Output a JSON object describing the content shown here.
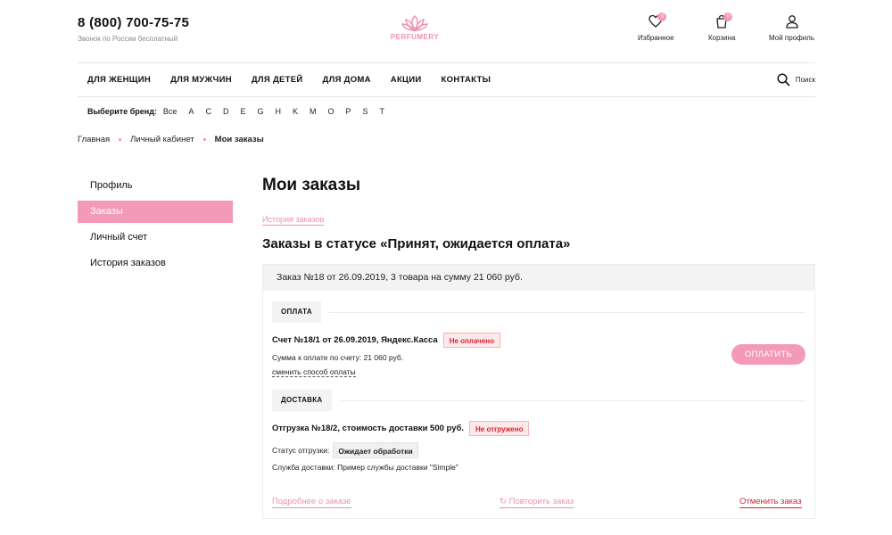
{
  "header": {
    "phone": "8 (800) 700-75-75",
    "phone_note": "Звонок по России бесплатный",
    "logo_text": "PERFUMERY",
    "favorites": {
      "label": "Избранное",
      "count": "0"
    },
    "cart": {
      "label": "Корзина",
      "count": "0"
    },
    "profile": {
      "label": "Мой профиль"
    }
  },
  "nav": {
    "items": [
      "ДЛЯ ЖЕНЩИН",
      "ДЛЯ МУЖЧИН",
      "ДЛЯ ДЕТЕЙ",
      "ДЛЯ ДОМА",
      "АКЦИИ",
      "КОНТАКТЫ"
    ],
    "search_label": "Поиск"
  },
  "brands": {
    "label": "Выберите бренд:",
    "letters": [
      "Все",
      "A",
      "C",
      "D",
      "E",
      "G",
      "H",
      "K",
      "M",
      "O",
      "P",
      "S",
      "T"
    ]
  },
  "breadcrumb": [
    "Главная",
    "Личный кабинет",
    "Мои заказы"
  ],
  "sidebar": {
    "items": [
      "Профиль",
      "Заказы",
      "Личный счет",
      "История заказов"
    ],
    "active_index": 1
  },
  "main": {
    "title": "Мои заказы",
    "history_link": "История заказов",
    "status_title": "Заказы в статусе «Принят, ожидается оплата»"
  },
  "order": {
    "header": "Заказ №18 от 26.09.2019, 3 товара на сумму 21 060 руб.",
    "payment": {
      "section": "ОПЛАТА",
      "invoice": "Счет №18/1 от 26.09.2019, Яндекс.Касса",
      "status": "Не оплачено",
      "amount": "Сумма к оплате по счету: 21 060 руб.",
      "change_link": "сменить способ оплаты",
      "pay_button": "ОПЛАТИТЬ"
    },
    "delivery": {
      "section": "ДОСТАВКА",
      "shipment": "Отгрузка №18/2, стоимость доставки 500 руб.",
      "status": "Не отгружено",
      "ship_status_label": "Статус отгрузки:",
      "ship_status_value": "Ожидает обработки",
      "service": "Служба доставки: Пример службы доставки \"Simple\""
    },
    "footer": {
      "details": "Подробнее о заказе",
      "repeat": "Повторить заказ",
      "cancel": "Отменить заказ"
    }
  },
  "colors": {
    "accent": "#f49ab9",
    "danger": "#d8262e"
  }
}
